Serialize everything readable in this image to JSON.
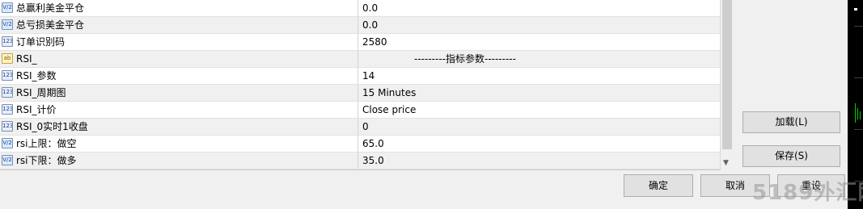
{
  "parameters": [
    {
      "type_icon": "V/2",
      "icon_kind": "dbl",
      "name": "总赢利美金平仓",
      "value": "0.0"
    },
    {
      "type_icon": "V/2",
      "icon_kind": "dbl",
      "name": "总亏损美金平仓",
      "value": "0.0"
    },
    {
      "type_icon": "123",
      "icon_kind": "int",
      "name": "订单识别码",
      "value": "2580"
    },
    {
      "type_icon": "ab",
      "icon_kind": "str",
      "name": "RSI_",
      "value": "---------指标参数---------"
    },
    {
      "type_icon": "123",
      "icon_kind": "int",
      "name": "RSI_参数",
      "value": "14"
    },
    {
      "type_icon": "123",
      "icon_kind": "int",
      "name": "RSI_周期图",
      "value": "15 Minutes"
    },
    {
      "type_icon": "123",
      "icon_kind": "int",
      "name": "RSI_计价",
      "value": "Close price"
    },
    {
      "type_icon": "123",
      "icon_kind": "int",
      "name": "RSI_0实时1收盘",
      "value": "0"
    },
    {
      "type_icon": "V/2",
      "icon_kind": "dbl",
      "name": "rsi上限：做空",
      "value": "65.0"
    },
    {
      "type_icon": "V/2",
      "icon_kind": "dbl",
      "name": "rsi下限：做多",
      "value": "35.0"
    }
  ],
  "buttons": {
    "load": "加载(L)",
    "save": "保存(S)",
    "ok": "确定",
    "cancel": "取消",
    "reset": "重设"
  },
  "watermark": "5189外汇网"
}
